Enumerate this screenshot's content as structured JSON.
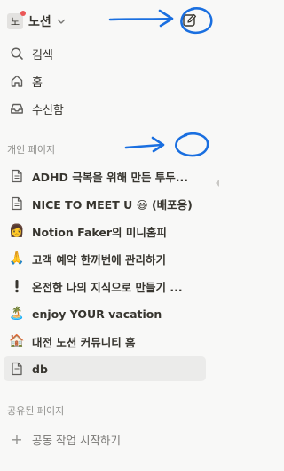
{
  "workspace": {
    "avatar_text": "노",
    "name": "노션"
  },
  "nav": {
    "search": "검색",
    "home": "홈",
    "inbox": "수신함"
  },
  "private_section": {
    "label": "개인 페이지",
    "pages": [
      {
        "icon": "document-icon",
        "label": "ADHD 극복을 위해 만든 투두..."
      },
      {
        "icon": "document-icon",
        "label": "NICE TO MEET U 😃 (배포용)"
      },
      {
        "icon": "user-emoji",
        "glyph": "👩",
        "label": "Notion Faker의 미니홈피"
      },
      {
        "icon": "praying-hands-emoji",
        "glyph": "🙏",
        "label": "고객 예약 한꺼번에 관리하기"
      },
      {
        "icon": "exclamation-emoji",
        "glyph": "❕",
        "label": "온전한 나의 지식으로 만들기 ..."
      },
      {
        "icon": "island-emoji",
        "glyph": "🏝️",
        "label": "enjoy YOUR vacation"
      },
      {
        "icon": "house-emoji",
        "glyph": "🏠",
        "label": "대전 노션 커뮤니티 홈"
      },
      {
        "icon": "document-icon",
        "label": "db"
      }
    ]
  },
  "shared_section": {
    "label": "공유된 페이지",
    "add_label": "공동 작업 시작하기"
  },
  "colors": {
    "sidebar_bg": "#f8f8f7",
    "text": "#37352f",
    "muted": "#91918e",
    "active_bg": "#ebebea",
    "annotation": "#1a73e8",
    "notification_dot": "#eb5757"
  }
}
